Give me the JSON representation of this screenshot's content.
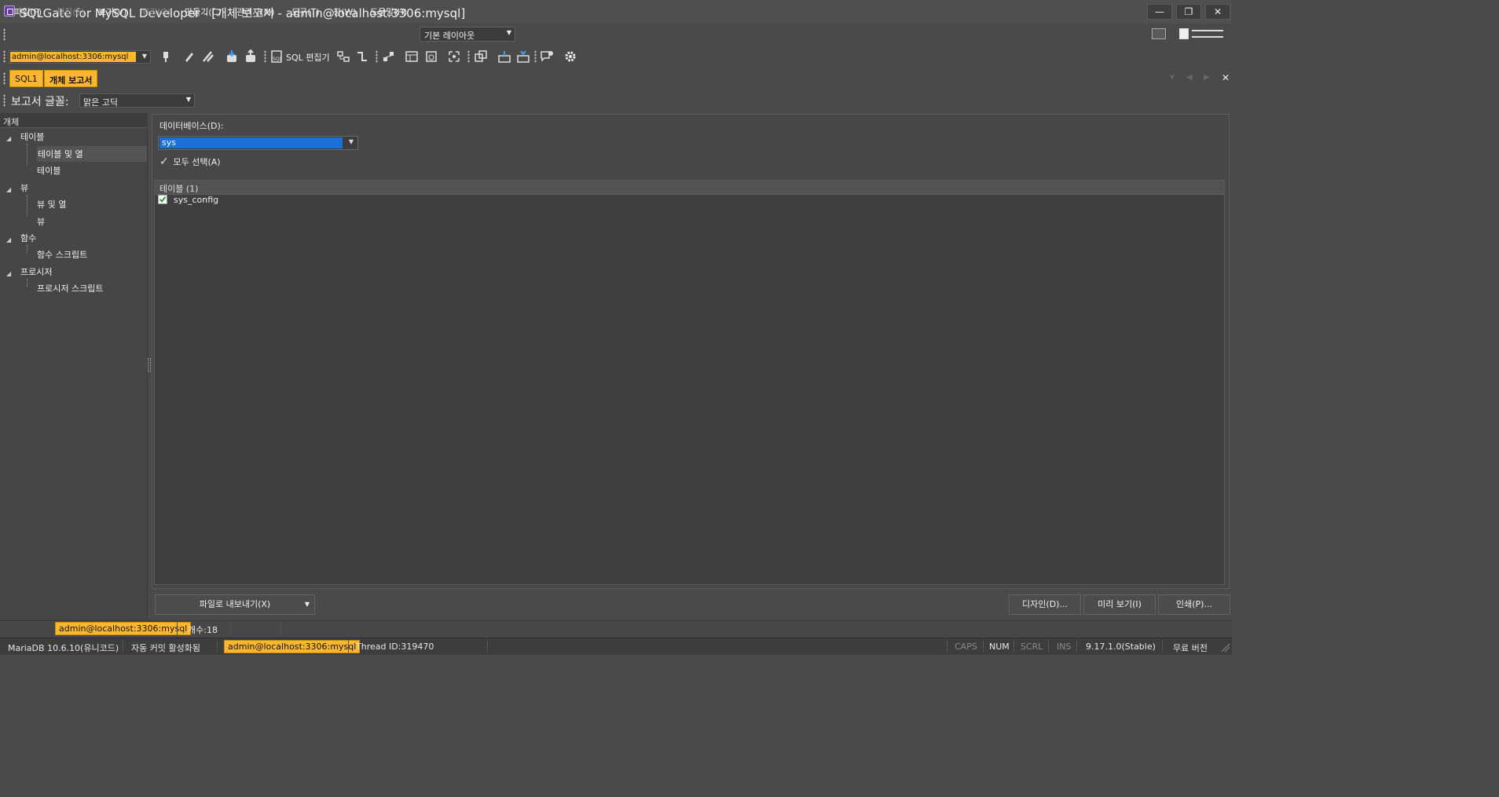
{
  "window": {
    "title": "SQLGate for MySQL Developer - [개체 보고서 - admin@localhost:3306:mysql]",
    "minimize": "—",
    "maximize": "❐",
    "close": "✕"
  },
  "menu": {
    "items": [
      "파일(F)",
      "편집(E)",
      "보기(V)",
      "쿼리(Q)",
      "만들기(C)",
      "관리자(M)",
      "도구(T)",
      "창(W)",
      "도움말(H)"
    ],
    "layout": "기본 레이아웃"
  },
  "toolbar": {
    "connection": "admin@localhost:3306:mysql",
    "sql_editor_label": "SQL 편집기"
  },
  "doc_tabs": [
    "SQL1",
    "개체 보고서"
  ],
  "report_font": {
    "label": "보고서 글꼴:",
    "value": "맑은 고딕"
  },
  "tree": {
    "header": "개체",
    "groups": [
      {
        "label": "테이블",
        "children": [
          "테이블 및 열",
          "테이블"
        ]
      },
      {
        "label": "뷰",
        "children": [
          "뷰 및 열",
          "뷰"
        ]
      },
      {
        "label": "함수",
        "children": [
          "함수 스크립트"
        ]
      },
      {
        "label": "프로시저",
        "children": [
          "프로시저 스크립트"
        ]
      }
    ]
  },
  "main": {
    "database_label": "데이터베이스(D):",
    "database_value": "sys",
    "select_all": "모두 선택(A)",
    "list_header": "테이블 (1)",
    "rows": [
      "sys_config"
    ]
  },
  "buttons": {
    "export": "파일로 내보내기(X)",
    "design": "디자인(D)...",
    "preview": "미리 보기(I)",
    "print": "인쇄(P)..."
  },
  "lower_strip": {
    "connection": "admin@localhost:3306:mysql",
    "count": "개수:18"
  },
  "status": {
    "server": "MariaDB 10.6.10(유니코드)",
    "autocommit": "자동 커밋 활성화됨",
    "connection": "admin@localhost:3306:mysql",
    "thread": "Thread ID:319470",
    "caps": "CAPS",
    "num": "NUM",
    "scrl": "SCRL",
    "ins": "INS",
    "version": "9.17.1.0(Stable)",
    "edition": "무료 버전"
  },
  "colors": {
    "accent": "#ffb732",
    "selection": "#1b6fd8",
    "background": "#4a4a4a"
  }
}
